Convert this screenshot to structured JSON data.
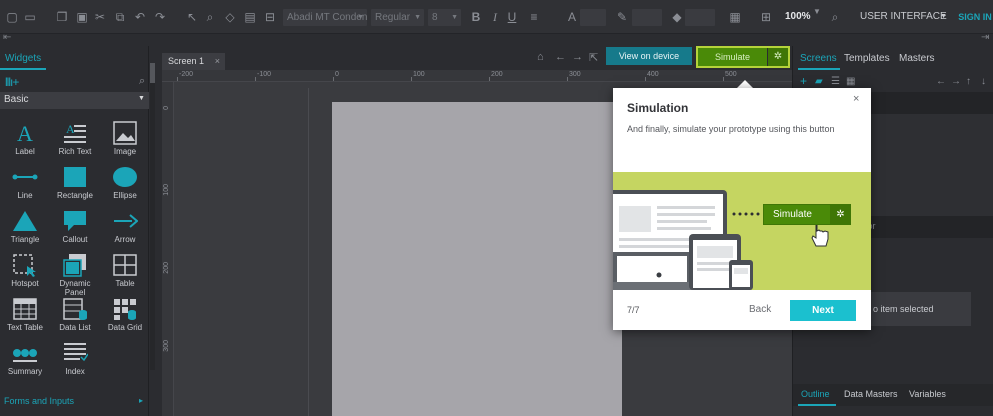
{
  "toolbar": {
    "font_family": "Abadi MT Condens",
    "font_style": "Regular",
    "font_size": "8",
    "zoom": "100%",
    "mode": "USER INTERFACE",
    "sign_in": "SIGN IN"
  },
  "left_panel": {
    "tab": "Widgets",
    "category": "Basic",
    "widgets": [
      {
        "label": "Label",
        "icon": "label-icon"
      },
      {
        "label": "Rich Text",
        "icon": "rich-text-icon"
      },
      {
        "label": "Image",
        "icon": "image-icon"
      },
      {
        "label": "Line",
        "icon": "line-icon"
      },
      {
        "label": "Rectangle",
        "icon": "rectangle-icon"
      },
      {
        "label": "Ellipse",
        "icon": "ellipse-icon"
      },
      {
        "label": "Triangle",
        "icon": "triangle-icon"
      },
      {
        "label": "Callout",
        "icon": "callout-icon"
      },
      {
        "label": "Arrow",
        "icon": "arrow-icon"
      },
      {
        "label": "Hotspot",
        "icon": "hotspot-icon"
      },
      {
        "label": "Dynamic Panel",
        "icon": "dynamic-panel-icon"
      },
      {
        "label": "Table",
        "icon": "table-icon"
      },
      {
        "label": "Text Table",
        "icon": "text-table-icon"
      },
      {
        "label": "Data List",
        "icon": "data-list-icon"
      },
      {
        "label": "Data Grid",
        "icon": "data-grid-icon"
      },
      {
        "label": "Summary",
        "icon": "summary-icon"
      },
      {
        "label": "Index",
        "icon": "index-icon"
      }
    ],
    "next_category": "Forms and Inputs"
  },
  "canvas": {
    "tab": "Screen 1",
    "ruler_h": [
      "-200",
      "-100",
      "0",
      "100",
      "200",
      "300",
      "400",
      "500"
    ],
    "ruler_v": [
      "0",
      "100",
      "200",
      "300"
    ],
    "view_on_device": "View on device",
    "simulate": "Simulate"
  },
  "right_panel": {
    "tabs": [
      "Screens",
      "Templates",
      "Masters"
    ],
    "navigator": "gator",
    "no_item": "o item selected",
    "bottom_tabs": [
      "Outline",
      "Data Masters",
      "Variables"
    ]
  },
  "popup": {
    "title": "Simulation",
    "text": "And finally, simulate your prototype using this button",
    "art_button": "Simulate",
    "progress": "7/7",
    "back": "Back",
    "next": "Next"
  },
  "colors": {
    "accent": "#1ba5b8",
    "simulate_green": "#4a8a08",
    "highlight": "#b5d33a",
    "next_button": "#1bc0cf"
  }
}
